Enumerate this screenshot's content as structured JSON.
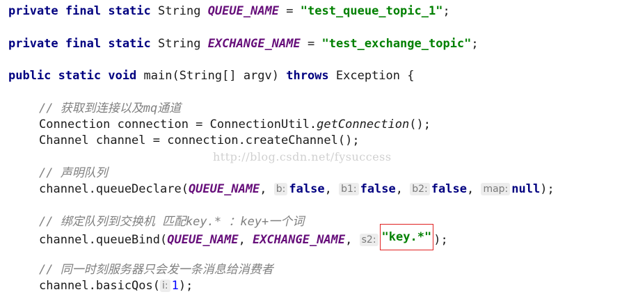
{
  "code": {
    "l1": {
      "kw_private": "private",
      "kw_final": "final",
      "kw_static": "static",
      "type": "String",
      "name": "QUEUE_NAME",
      "eq": " = ",
      "value": "\"test_queue_topic_1\"",
      "semi": ";"
    },
    "l2": {
      "kw_private": "private",
      "kw_final": "final",
      "kw_static": "static",
      "type": "String",
      "name": "EXCHANGE_NAME",
      "eq": " = ",
      "value": "\"test_exchange_topic\"",
      "semi": ";"
    },
    "l3": {
      "kw_public": "public",
      "kw_static": "static",
      "kw_void": "void",
      "sig": " main(String[] argv) ",
      "kw_throws": "throws",
      "rest": " Exception {"
    },
    "c1": "// 获取到连接以及mq通道",
    "l4": {
      "a": "Connection connection = ConnectionUtil.",
      "m": "getConnection",
      "b": "();"
    },
    "l5": "Channel channel = connection.createChannel();",
    "c2": "// 声明队列",
    "l6": {
      "a": "channel.queueDeclare(",
      "arg1": "QUEUE_NAME",
      "hint_b": "b:",
      "v_b": "false",
      "hint_b1": "b1:",
      "v_b1": "false",
      "hint_b2": "b2:",
      "v_b2": "false",
      "hint_map": "map:",
      "v_map": "null",
      "end": ");"
    },
    "c3": "// 绑定队列到交换机 匹配key.* ：key+一个词",
    "l7": {
      "a": "channel.queueBind(",
      "arg1": "QUEUE_NAME",
      "arg2": "EXCHANGE_NAME",
      "hint_s2": "s2:",
      "v_s2": "\"key.*\"",
      "end": ");"
    },
    "c4": "// 同一时刻服务器只会发一条消息给消费者",
    "l8": {
      "a": "channel.basicQos(",
      "hint_i": "i:",
      "v_i": "1",
      "end": ");"
    }
  },
  "watermark": "http://blog.csdn.net/fysuccess",
  "colors": {
    "keyword": "#000080",
    "constant": "#660e7a",
    "string": "#008000",
    "number": "#0000ff",
    "comment": "#808080",
    "highlight_box": "#e02020"
  }
}
